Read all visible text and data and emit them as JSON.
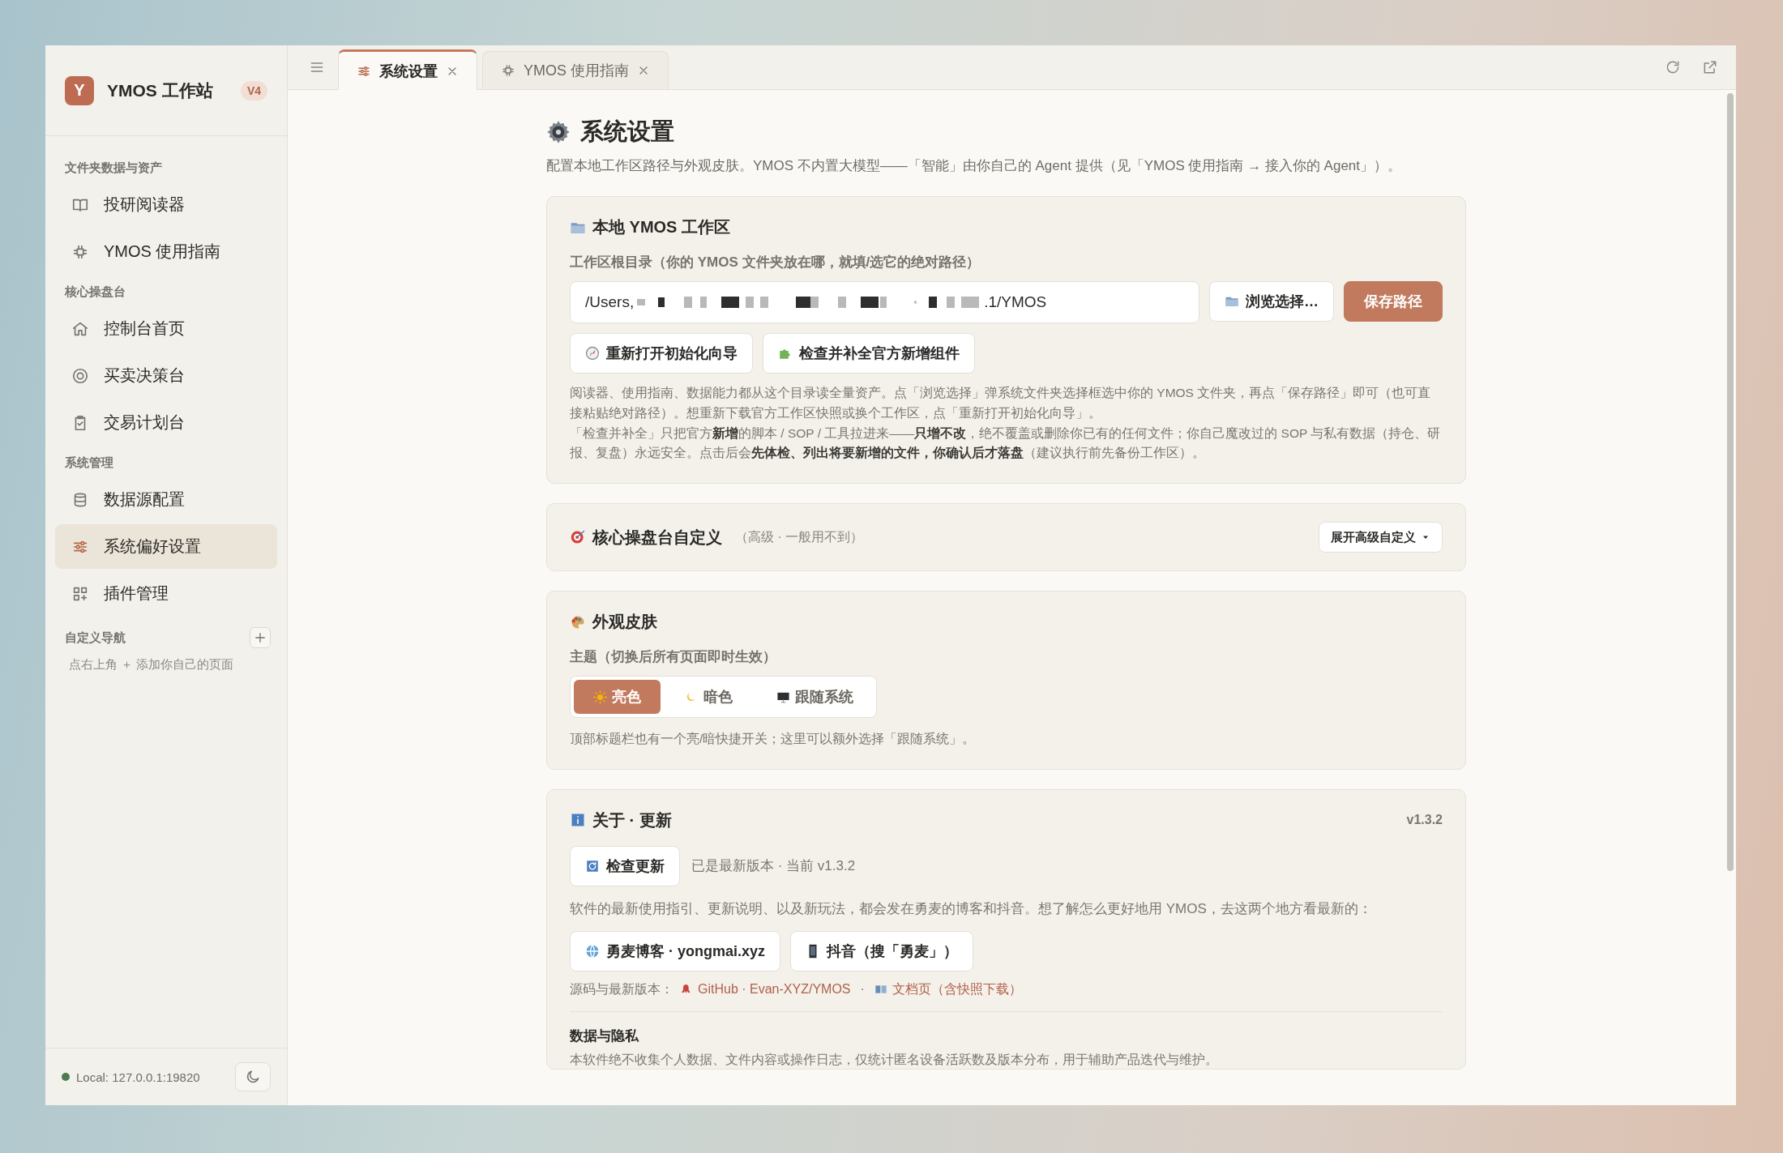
{
  "app": {
    "logo_letter": "Y",
    "name": "YMOS 工作站",
    "version": "V4"
  },
  "sidebar": {
    "sections": [
      {
        "title": "文件夹数据与资产",
        "items": [
          {
            "label": "投研阅读器",
            "selected": false
          },
          {
            "label": "YMOS 使用指南",
            "selected": false
          }
        ]
      },
      {
        "title": "核心操盘台",
        "items": [
          {
            "label": "控制台首页",
            "selected": false
          },
          {
            "label": "买卖决策台",
            "selected": false
          },
          {
            "label": "交易计划台",
            "selected": false
          }
        ]
      },
      {
        "title": "系统管理",
        "items": [
          {
            "label": "数据源配置",
            "selected": false
          },
          {
            "label": "系统偏好设置",
            "selected": true
          },
          {
            "label": "插件管理",
            "selected": false
          }
        ]
      }
    ],
    "custom_nav": {
      "title": "自定义导航",
      "hint": "点右上角 ＋ 添加你自己的页面"
    },
    "status": "Local: 127.0.0.1:19820"
  },
  "tabs": [
    {
      "label": "系统设置",
      "selected": true
    },
    {
      "label": "YMOS 使用指南",
      "selected": false
    }
  ],
  "page": {
    "title": "系统设置",
    "subtitle": "配置本地工作区路径与外观皮肤。YMOS 不内置大模型——「智能」由你自己的 Agent 提供（见「YMOS 使用指南 → 接入你的 Agent」）。"
  },
  "workspace": {
    "title": "本地 YMOS 工作区",
    "field_label": "工作区根目录（你的 YMOS 文件夹放在哪，就填/选它的绝对路径）",
    "path_start": "/Users,",
    "path_end": ".1/YMOS",
    "browse_button": "浏览选择…",
    "save_button": "保存路径",
    "actions": [
      "重新打开初始化向导",
      "检查并补全官方新增组件"
    ],
    "notes": [
      "阅读器、使用指南、数据能力都从这个目录读全量资产。点「浏览选择」弹系统文件夹选择框选中你的 YMOS 文件夹，再点「保存路径」即可（也可直接粘贴绝对路径）。想重新下载官方工作区快照或换个工作区，点「重新打开初始化向导」。",
      "「检查并补全」只把官方**新增**的脚本 / SOP / 工具拉进来——**只增不改**，绝不覆盖或删除你已有的任何文件；你自己魔改过的 SOP 与私有数据（持仓、研报、复盘）永远安全。点击后会**先体检、列出将要新增的文件，你确认后才落盘**（建议执行前先备份工作区）。"
    ]
  },
  "core": {
    "title": "核心操盘台自定义",
    "hint": "（高级 · 一般用不到）",
    "button": "展开高级自定义"
  },
  "appearance": {
    "title": "外观皮肤",
    "label": "主题（切换后所有页面即时生效）",
    "options": [
      {
        "label": "亮色",
        "selected": true
      },
      {
        "label": "暗色",
        "selected": false
      },
      {
        "label": "跟随系统",
        "selected": false
      }
    ],
    "hint": "顶部标题栏也有一个亮/暗快捷开关；这里可以额外选择「跟随系统」。"
  },
  "about": {
    "title": "关于 · 更新",
    "version": "v1.3.2",
    "check_button": "检查更新",
    "status": "已是最新版本 · 当前 v1.3.2",
    "description": "软件的最新使用指引、更新说明、以及新玩法，都会发在勇麦的博客和抖音。想了解怎么更好地用 YMOS，去这两个地方看最新的：",
    "links": [
      "勇麦博客 · yongmai.xyz",
      "抖音（搜「勇麦」）"
    ],
    "source_label": "源码与最新版本：",
    "source_links": [
      "GitHub · Evan-XYZ/YMOS",
      "文档页（含快照下载）"
    ],
    "separator": "·",
    "privacy_title": "数据与隐私",
    "privacy_text": "本软件绝不收集个人数据、文件内容或操作日志，仅统计匿名设备活跃数及版本分布，用于辅助产品迭代与维护。"
  }
}
